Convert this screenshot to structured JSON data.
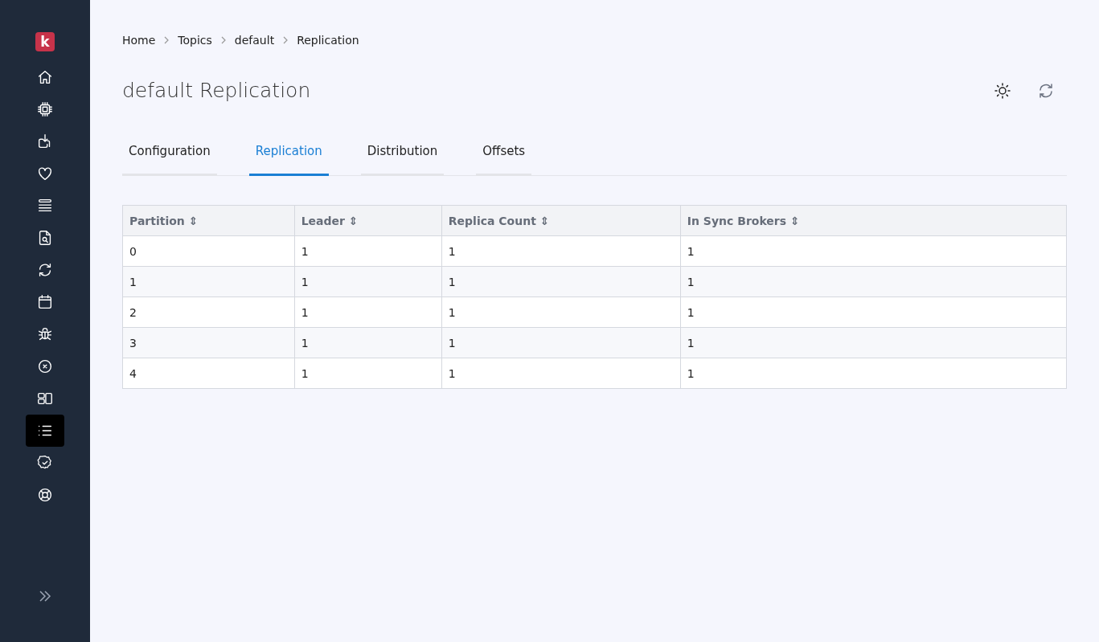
{
  "sidebar": {
    "logo": "k",
    "items": [
      {
        "kind": "home",
        "selected": false
      },
      {
        "kind": "chip",
        "selected": false
      },
      {
        "kind": "download",
        "selected": false
      },
      {
        "kind": "heart",
        "selected": false
      },
      {
        "kind": "stack",
        "selected": false
      },
      {
        "kind": "file-search",
        "selected": false
      },
      {
        "kind": "refresh",
        "selected": false
      },
      {
        "kind": "calendar",
        "selected": false
      },
      {
        "kind": "bug",
        "selected": false
      },
      {
        "kind": "x-circle",
        "selected": false
      },
      {
        "kind": "layout",
        "selected": false
      },
      {
        "kind": "list",
        "selected": true
      },
      {
        "kind": "badge-check",
        "selected": false
      },
      {
        "kind": "lifebuoy",
        "selected": false
      }
    ]
  },
  "breadcrumb": [
    "Home",
    "Topics",
    "default",
    "Replication"
  ],
  "page_title": "default Replication",
  "tabs": [
    {
      "label": "Configuration",
      "selected": false
    },
    {
      "label": "Replication",
      "selected": true
    },
    {
      "label": "Distribution",
      "selected": false
    },
    {
      "label": "Offsets",
      "selected": false
    }
  ],
  "table": {
    "columns": [
      {
        "label": "Partition",
        "sort": "⇕"
      },
      {
        "label": "Leader",
        "sort": "⇕"
      },
      {
        "label": "Replica Count",
        "sort": "⇕"
      },
      {
        "label": "In Sync Brokers",
        "sort": "⇕"
      }
    ],
    "rows": [
      [
        "0",
        "1",
        "1",
        "1"
      ],
      [
        "1",
        "1",
        "1",
        "1"
      ],
      [
        "2",
        "1",
        "1",
        "1"
      ],
      [
        "3",
        "1",
        "1",
        "1"
      ],
      [
        "4",
        "1",
        "1",
        "1"
      ]
    ]
  }
}
